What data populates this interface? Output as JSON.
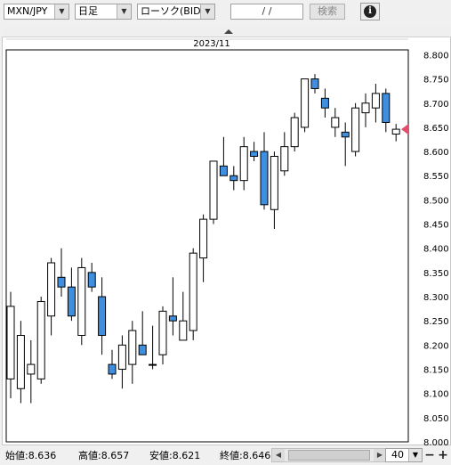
{
  "toolbar": {
    "pair": "MXN/JPY",
    "period": "日足",
    "chart_type": "ローソク(BID)",
    "date": "/ /",
    "search_label": "検索",
    "info_icon": "info-icon",
    "dropdown_icon": "chevron-down-icon"
  },
  "chart": {
    "month_label": "2023/11",
    "current_price_marker_color": "#e0506e",
    "up_color": "#ffffff",
    "down_color": "#3f8fe0",
    "price_labels": [
      "8.800",
      "8.750",
      "8.700",
      "8.650",
      "8.600",
      "8.550",
      "8.500",
      "8.450",
      "8.400",
      "8.350",
      "8.300",
      "8.250",
      "8.200",
      "8.150",
      "8.100",
      "8.050",
      "8.000"
    ]
  },
  "chart_data": {
    "type": "candlestick",
    "ylim": [
      8.0,
      8.81
    ],
    "grid": false,
    "candles": [
      {
        "o": 8.13,
        "h": 8.31,
        "l": 8.09,
        "c": 8.28
      },
      {
        "o": 8.11,
        "h": 8.25,
        "l": 8.08,
        "c": 8.22
      },
      {
        "o": 8.14,
        "h": 8.21,
        "l": 8.08,
        "c": 8.16
      },
      {
        "o": 8.13,
        "h": 8.3,
        "l": 8.12,
        "c": 8.29
      },
      {
        "o": 8.26,
        "h": 8.38,
        "l": 8.22,
        "c": 8.37
      },
      {
        "o": 8.34,
        "h": 8.4,
        "l": 8.3,
        "c": 8.32
      },
      {
        "o": 8.32,
        "h": 8.36,
        "l": 8.25,
        "c": 8.26
      },
      {
        "o": 8.22,
        "h": 8.38,
        "l": 8.2,
        "c": 8.36
      },
      {
        "o": 8.35,
        "h": 8.37,
        "l": 8.31,
        "c": 8.32
      },
      {
        "o": 8.3,
        "h": 8.34,
        "l": 8.18,
        "c": 8.22
      },
      {
        "o": 8.16,
        "h": 8.19,
        "l": 8.13,
        "c": 8.14
      },
      {
        "o": 8.15,
        "h": 8.22,
        "l": 8.11,
        "c": 8.2
      },
      {
        "o": 8.16,
        "h": 8.25,
        "l": 8.12,
        "c": 8.23
      },
      {
        "o": 8.2,
        "h": 8.27,
        "l": 8.18,
        "c": 8.18
      },
      {
        "o": 8.16,
        "h": 8.24,
        "l": 8.15,
        "c": 8.16
      },
      {
        "o": 8.18,
        "h": 8.28,
        "l": 8.16,
        "c": 8.27
      },
      {
        "o": 8.26,
        "h": 8.34,
        "l": 8.22,
        "c": 8.25
      },
      {
        "o": 8.21,
        "h": 8.31,
        "l": 8.21,
        "c": 8.25
      },
      {
        "o": 8.23,
        "h": 8.4,
        "l": 8.21,
        "c": 8.39
      },
      {
        "o": 8.38,
        "h": 8.47,
        "l": 8.33,
        "c": 8.46
      },
      {
        "o": 8.46,
        "h": 8.57,
        "l": 8.45,
        "c": 8.58
      },
      {
        "o": 8.57,
        "h": 8.63,
        "l": 8.55,
        "c": 8.55
      },
      {
        "o": 8.55,
        "h": 8.57,
        "l": 8.52,
        "c": 8.54
      },
      {
        "o": 8.54,
        "h": 8.63,
        "l": 8.52,
        "c": 8.61
      },
      {
        "o": 8.6,
        "h": 8.62,
        "l": 8.58,
        "c": 8.59
      },
      {
        "o": 8.6,
        "h": 8.64,
        "l": 8.48,
        "c": 8.49
      },
      {
        "o": 8.48,
        "h": 8.6,
        "l": 8.44,
        "c": 8.59
      },
      {
        "o": 8.56,
        "h": 8.64,
        "l": 8.55,
        "c": 8.61
      },
      {
        "o": 8.61,
        "h": 8.68,
        "l": 8.6,
        "c": 8.67
      },
      {
        "o": 8.65,
        "h": 8.75,
        "l": 8.64,
        "c": 8.75
      },
      {
        "o": 8.75,
        "h": 8.76,
        "l": 8.72,
        "c": 8.73
      },
      {
        "o": 8.71,
        "h": 8.73,
        "l": 8.67,
        "c": 8.69
      },
      {
        "o": 8.65,
        "h": 8.69,
        "l": 8.63,
        "c": 8.67
      },
      {
        "o": 8.64,
        "h": 8.66,
        "l": 8.57,
        "c": 8.63
      },
      {
        "o": 8.6,
        "h": 8.7,
        "l": 8.59,
        "c": 8.69
      },
      {
        "o": 8.68,
        "h": 8.72,
        "l": 8.65,
        "c": 8.7
      },
      {
        "o": 8.69,
        "h": 8.74,
        "l": 8.66,
        "c": 8.72
      },
      {
        "o": 8.72,
        "h": 8.73,
        "l": 8.64,
        "c": 8.66
      },
      {
        "o": 8.636,
        "h": 8.657,
        "l": 8.621,
        "c": 8.646
      }
    ],
    "last_price": 8.646
  },
  "status": {
    "open": "始値:8.636",
    "high": "高値:8.657",
    "low": "安値:8.621",
    "close": "終値:8.646",
    "zoom": "40",
    "zoom_in_icon": "plus-icon",
    "zoom_out_icon": "minus-icon"
  }
}
